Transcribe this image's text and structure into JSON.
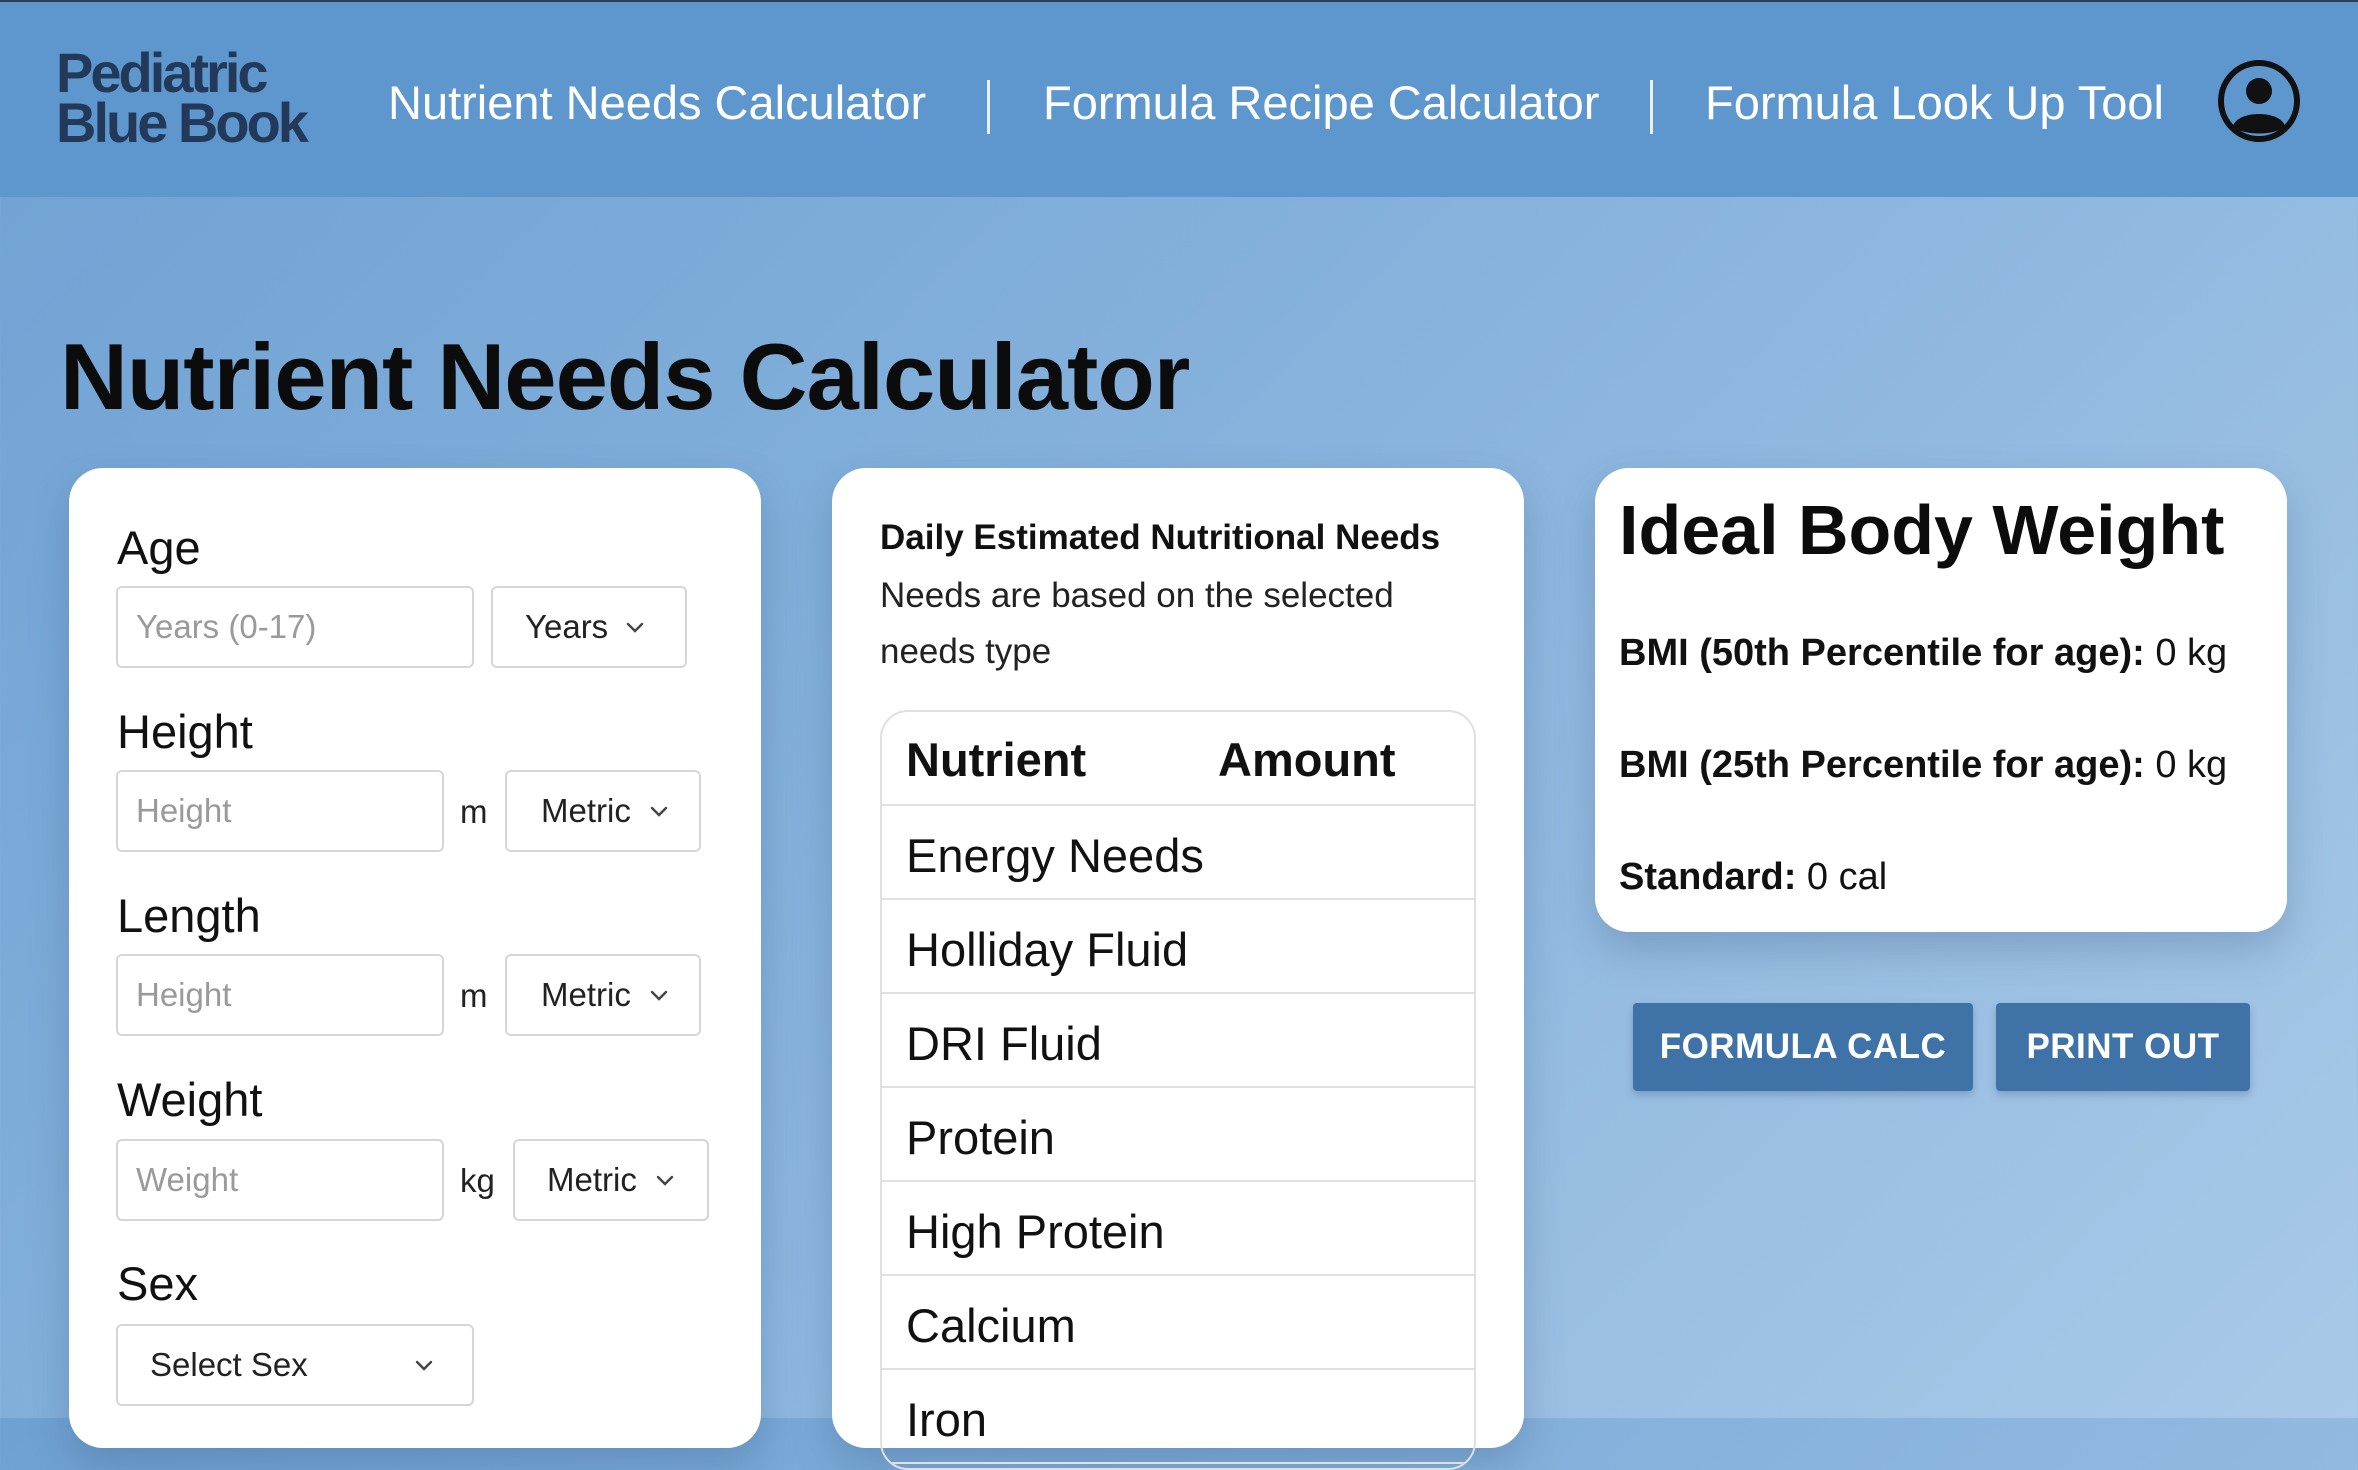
{
  "header": {
    "logo": {
      "line1": "Pediatric",
      "line2_prefix": "Blue B",
      "line2_oo": "oo",
      "line2_suffix": "k"
    },
    "nav": [
      {
        "label": "Nutrient Needs Calculator"
      },
      {
        "label": "Formula Recipe Calculator"
      },
      {
        "label": "Formula Look Up Tool"
      }
    ],
    "avatar_icon": "user-circle-icon"
  },
  "page_title": "Nutrient Needs Calculator",
  "form": {
    "age": {
      "label": "Age",
      "placeholder": "Years (0-17)",
      "unit_select": "Years"
    },
    "height": {
      "label": "Height",
      "placeholder": "Height",
      "unit": "m",
      "system_select": "Metric"
    },
    "length": {
      "label": "Length",
      "placeholder": "Height",
      "unit": "m",
      "system_select": "Metric"
    },
    "weight": {
      "label": "Weight",
      "placeholder": "Weight",
      "unit": "kg",
      "system_select": "Metric"
    },
    "sex": {
      "label": "Sex",
      "select": "Select Sex"
    }
  },
  "needs": {
    "title": "Daily Estimated Nutritional Needs",
    "subtitle": "Needs are based on the selected needs type",
    "columns": [
      "Nutrient",
      "Amount"
    ],
    "rows": [
      "Energy Needs",
      "Holliday Fluid",
      "DRI Fluid",
      "Protein",
      "High Protein",
      "Calcium",
      "Iron"
    ]
  },
  "ibw": {
    "title": "Ideal Body Weight",
    "bmi50_label": "BMI (50th Percentile for age):",
    "bmi50_value": "0 kg",
    "bmi25_label": "BMI (25th Percentile for age):",
    "bmi25_value": "0 kg",
    "standard_label": "Standard:",
    "standard_value": "0 cal"
  },
  "actions": {
    "formula_calc": "FORMULA CALC",
    "print_out": "PRINT OUT"
  },
  "colors": {
    "header_bg": "#5e97cd",
    "logo": "#23395a",
    "button_bg": "#3f73a8"
  }
}
